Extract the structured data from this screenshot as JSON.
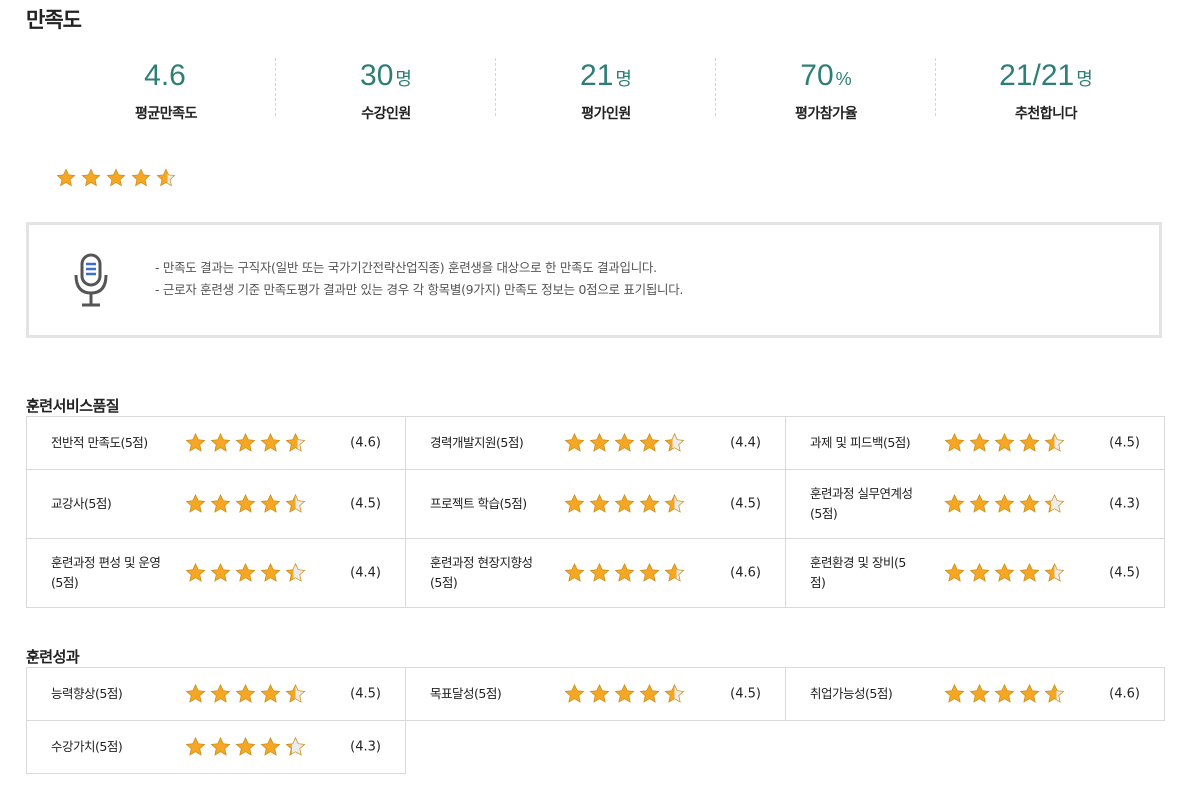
{
  "page": {
    "title": "만족도"
  },
  "summary": [
    {
      "value": "4.6",
      "unit": "",
      "label": "평균만족도"
    },
    {
      "value": "30",
      "unit": "명",
      "label": "수강인원"
    },
    {
      "value": "21",
      "unit": "명",
      "label": "평가인원"
    },
    {
      "value": "70",
      "unit": "%",
      "label": "평가참가율"
    },
    {
      "value": "21/21",
      "unit": "명",
      "label": "추천합니다"
    }
  ],
  "overall_rating": 4.6,
  "notice": {
    "icon": "microphone-icon",
    "lines": [
      "만족도 결과는 구직자(일반 또는 국가기간전략산업직종) 훈련생을 대상으로 한 만족도 결과입니다.",
      "근로자 훈련생 기준 만족도평가 결과만 있는 경우 각 항목별(9가지) 만족도 정보는 0점으로 표기됩니다."
    ]
  },
  "sections": [
    {
      "title": "훈련서비스품질",
      "items": [
        {
          "name": "전반적 만족도(5점)",
          "rating": 4.6,
          "score": "(4.6)"
        },
        {
          "name": "경력개발지원(5점)",
          "rating": 4.4,
          "score": "(4.4)"
        },
        {
          "name": "과제 및 피드백(5점)",
          "rating": 4.5,
          "score": "(4.5)"
        },
        {
          "name": "교강사(5점)",
          "rating": 4.5,
          "score": "(4.5)"
        },
        {
          "name": "프로젝트 학습(5점)",
          "rating": 4.5,
          "score": "(4.5)"
        },
        {
          "name": "훈련과정 실무연계성(5점)",
          "rating": 4.3,
          "score": "(4.3)"
        },
        {
          "name": "훈련과정 편성 및 운영(5점)",
          "rating": 4.4,
          "score": "(4.4)"
        },
        {
          "name": "훈련과정 현장지향성(5점)",
          "rating": 4.6,
          "score": "(4.6)"
        },
        {
          "name": "훈련환경 및 장비(5점)",
          "rating": 4.5,
          "score": "(4.5)"
        }
      ]
    },
    {
      "title": "훈련성과",
      "items": [
        {
          "name": "능력향상(5점)",
          "rating": 4.5,
          "score": "(4.5)"
        },
        {
          "name": "목표달성(5점)",
          "rating": 4.5,
          "score": "(4.5)"
        },
        {
          "name": "취업가능성(5점)",
          "rating": 4.6,
          "score": "(4.6)"
        },
        {
          "name": "수강가치(5점)",
          "rating": 4.3,
          "score": "(4.3)"
        }
      ]
    }
  ],
  "colors": {
    "accent": "#2e7e78",
    "star_fill": "#f5a623",
    "star_empty": "#d8d8d8"
  }
}
